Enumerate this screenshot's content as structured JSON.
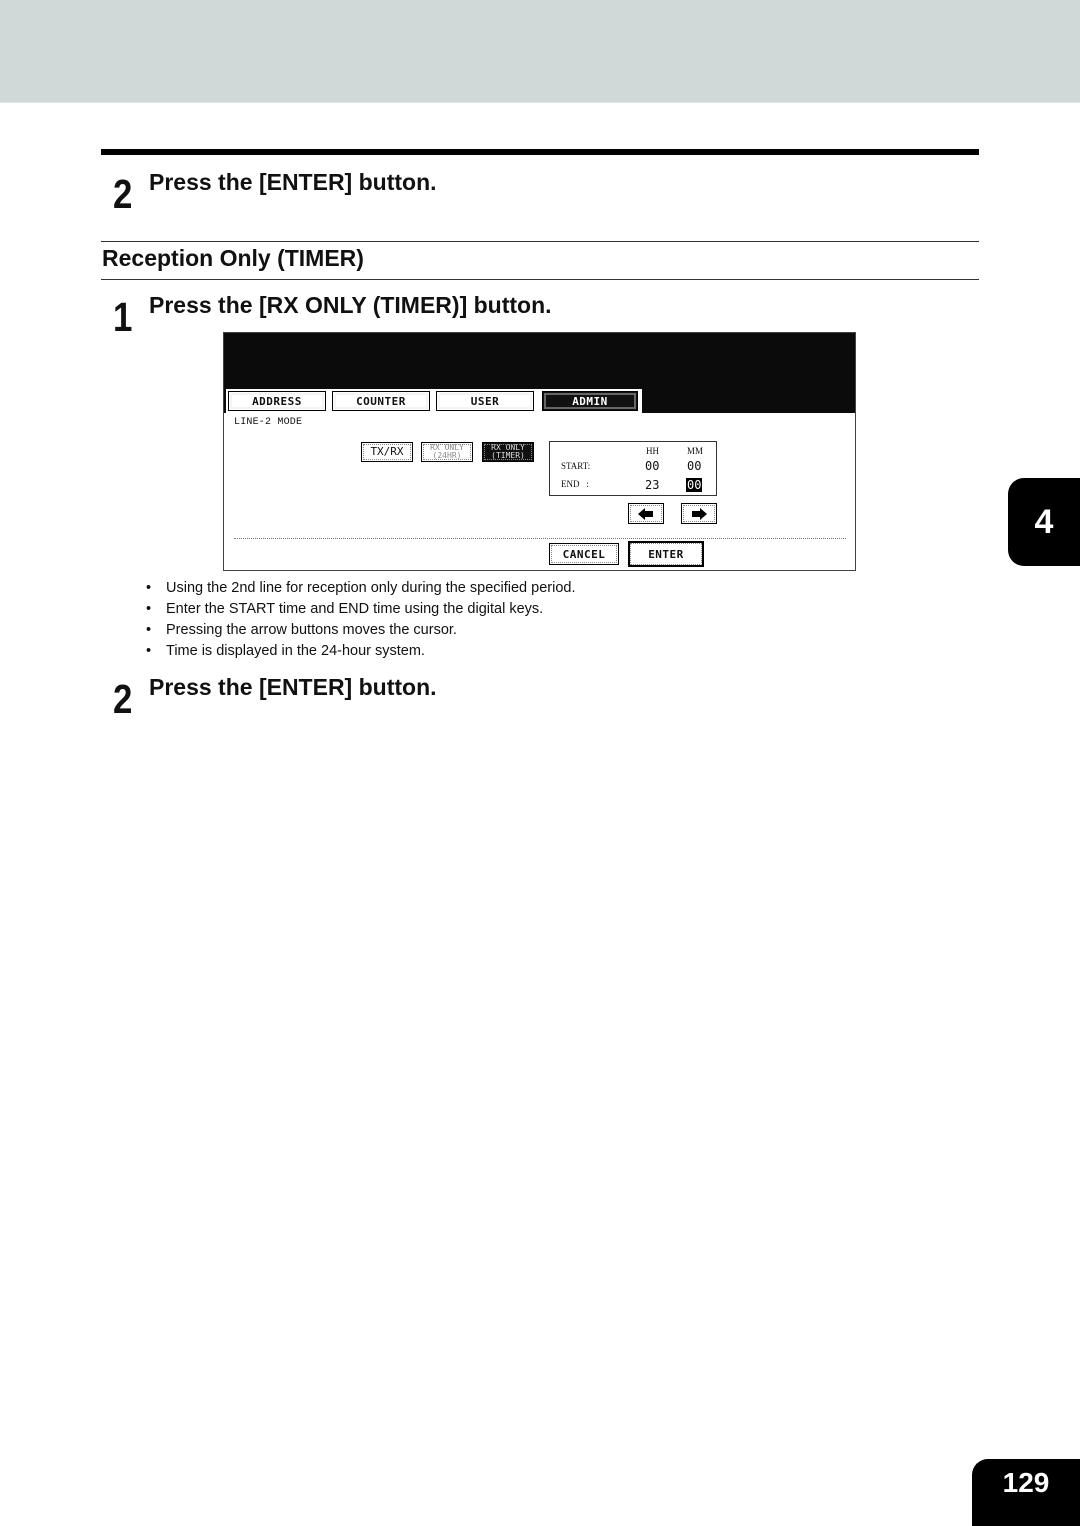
{
  "colors": {
    "header_band": "#d0d9d8",
    "ink": "#000000"
  },
  "prev_step": {
    "number": "2",
    "text": "Press the [ENTER] button."
  },
  "section": {
    "title": "Reception Only (TIMER)"
  },
  "step1": {
    "number": "1",
    "text": "Press the [RX ONLY (TIMER)] button."
  },
  "panel": {
    "tabs": [
      {
        "label": "ADDRESS",
        "active": false
      },
      {
        "label": "COUNTER",
        "active": false
      },
      {
        "label": "USER",
        "active": false
      },
      {
        "label": "ADMIN",
        "active": true
      }
    ],
    "mode_label": "LINE-2 MODE",
    "mode_buttons": [
      {
        "label": "TX/RX",
        "state": "normal"
      },
      {
        "label_line1": "RX ONLY",
        "label_line2": "(24HR)",
        "state": "dim"
      },
      {
        "label_line1": "RX ONLY",
        "label_line2": "(TIMER)",
        "state": "selected"
      }
    ],
    "time": {
      "col_hh": "HH",
      "col_mm": "MM",
      "start_label": "START:",
      "end_label": "END   :",
      "start_hh": "00",
      "start_mm": "00",
      "end_hh": "23",
      "end_mm": "00",
      "cursor_field": "end_mm"
    },
    "arrows": {
      "left": "left-arrow-icon",
      "right": "right-arrow-icon"
    },
    "cancel_label": "CANCEL",
    "enter_label": "ENTER"
  },
  "bullets": [
    "Using the 2nd line for reception only during the specified period.",
    "Enter the START time and END time using the digital keys.",
    "Pressing the arrow buttons moves the cursor.",
    "Time is displayed in the 24-hour system."
  ],
  "step2": {
    "number": "2",
    "text": "Press the [ENTER] button."
  },
  "chapter": "4",
  "page_number": "129"
}
